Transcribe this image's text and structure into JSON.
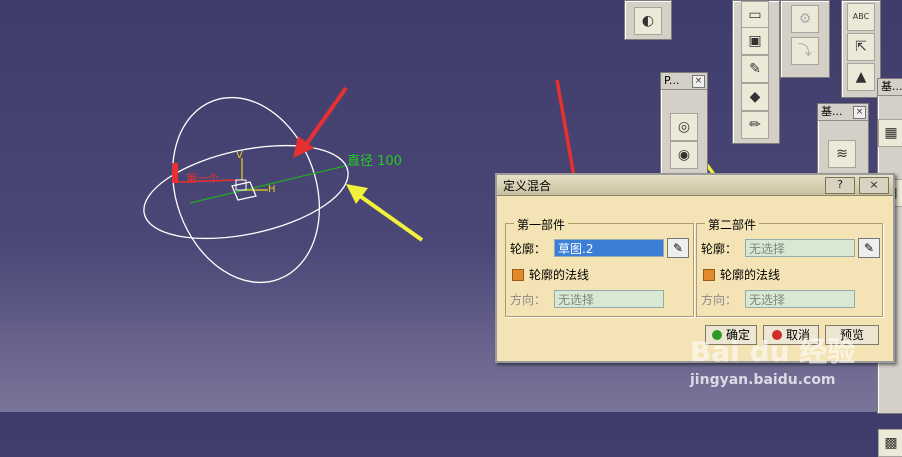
{
  "viewport": {
    "dimension_label": "直径 100",
    "sketch_label": "第一个",
    "axis_v": "V",
    "axis_h": "H"
  },
  "toolbars": {
    "profile_title": "P...",
    "base_title1": "基...",
    "base_title2": "基...",
    "abc_text": "ABC"
  },
  "dialog": {
    "title": "定义混合",
    "help": "?",
    "close": "×",
    "group1": {
      "legend": "第一部件",
      "profile_label": "轮廓：",
      "profile_value": "草图.2",
      "normal_label": "轮廓的法线",
      "direction_label": "方向：",
      "direction_value": "无选择"
    },
    "group2": {
      "legend": "第二部件",
      "profile_label": "轮廓：",
      "profile_value": "无选择",
      "normal_label": "轮廓的法线",
      "direction_label": "方向：",
      "direction_value": "无选择"
    },
    "buttons": {
      "ok": "确定",
      "cancel": "取消",
      "preview": "预览"
    }
  },
  "watermark": {
    "brand": "Bai du 经验",
    "url": "jingyan.baidu.com"
  },
  "colors": {
    "annotation_red": "#e83030",
    "annotation_yellow": "#f2f03a",
    "dimension_green": "#22aa22",
    "dialog_bg": "#f4e3b4",
    "selected_field": "#3a7ed8"
  }
}
